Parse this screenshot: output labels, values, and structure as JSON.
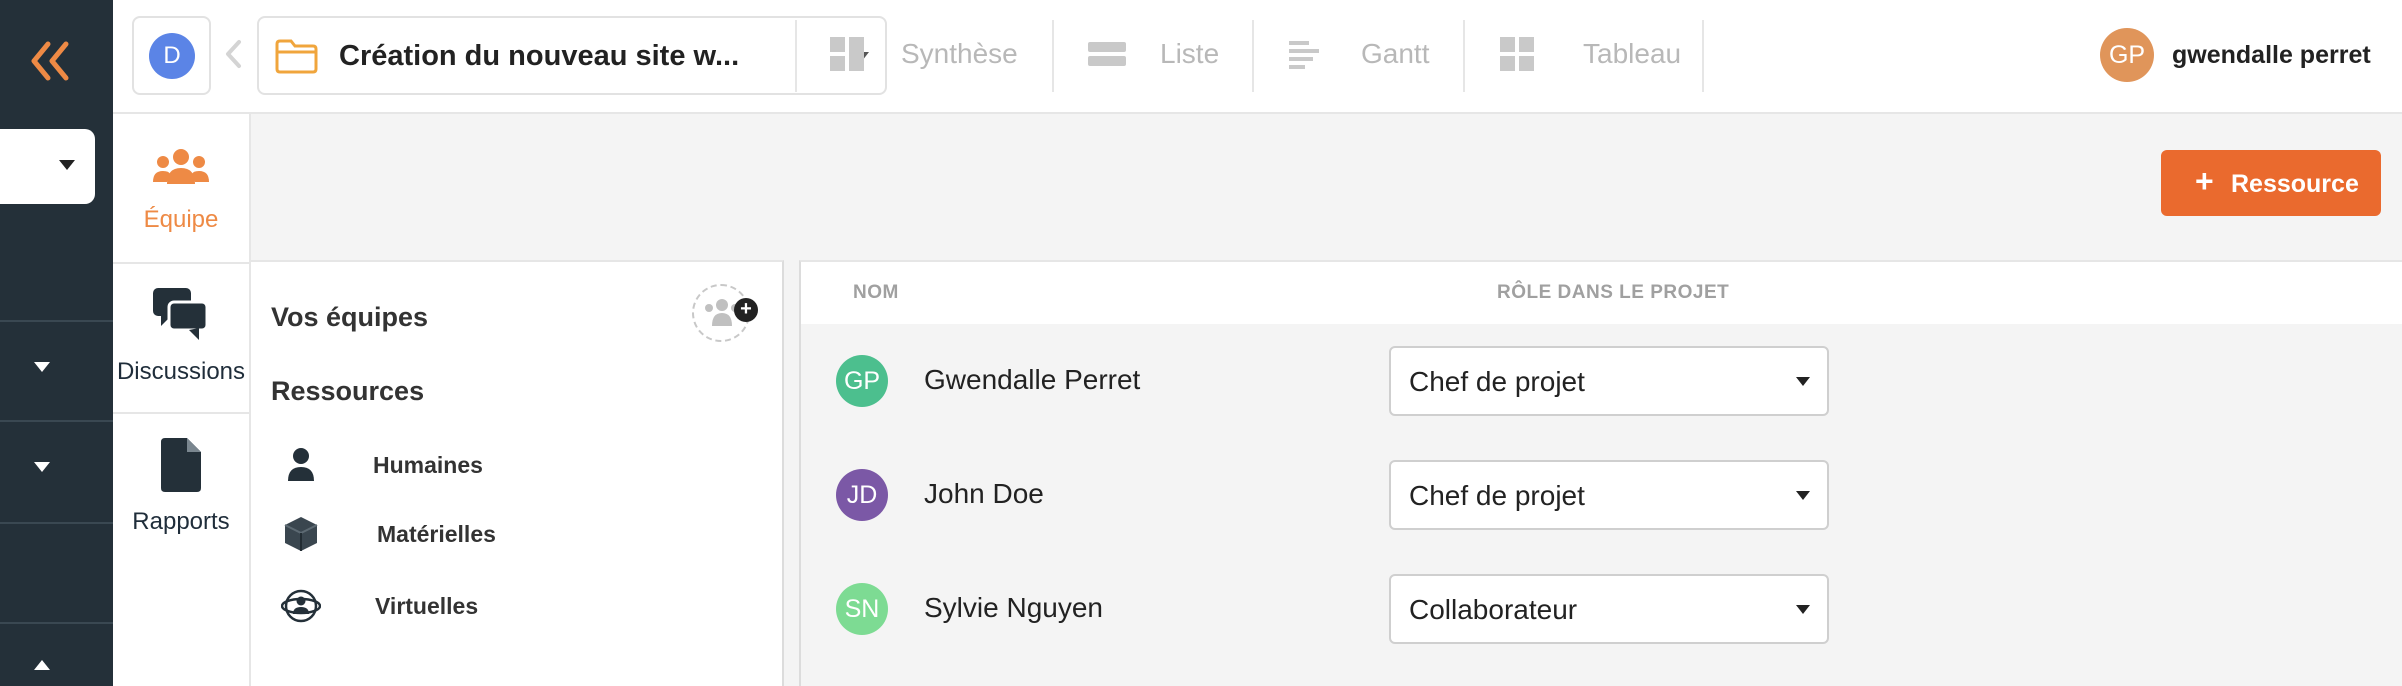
{
  "workspace": {
    "initial": "D"
  },
  "project": {
    "name": "Création du nouveau site w..."
  },
  "views": [
    {
      "label": "Synthèse",
      "icon": "synthesis-icon"
    },
    {
      "label": "Liste",
      "icon": "list-icon"
    },
    {
      "label": "Gantt",
      "icon": "gantt-icon"
    },
    {
      "label": "Tableau",
      "icon": "board-icon"
    }
  ],
  "user": {
    "initials": "GP",
    "name": "gwendalle perret"
  },
  "subnav": [
    {
      "label": "Équipe",
      "icon": "team-icon",
      "active": true
    },
    {
      "label": "Discussions",
      "icon": "discussions-icon",
      "active": false
    },
    {
      "label": "Rapports",
      "icon": "reports-icon",
      "active": false
    }
  ],
  "teams": {
    "title": "Vos équipes",
    "resources_title": "Ressources",
    "items": [
      {
        "label": "Humaines",
        "icon": "person-icon"
      },
      {
        "label": "Matérielles",
        "icon": "cube-icon"
      },
      {
        "label": "Virtuelles",
        "icon": "virtual-icon"
      }
    ]
  },
  "add_resource_button": {
    "label": "Ressource"
  },
  "table": {
    "columns": {
      "name": "NOM",
      "role": "RÔLE DANS LE PROJET"
    },
    "rows": [
      {
        "initials": "GP",
        "name": "Gwendalle Perret",
        "role": "Chef de projet",
        "color": "#4cbf8e"
      },
      {
        "initials": "JD",
        "name": "John Doe",
        "role": "Chef de projet",
        "color": "#7b58a6"
      },
      {
        "initials": "SN",
        "name": "Sylvie Nguyen",
        "role": "Collaborateur",
        "color": "#7ddb93"
      }
    ]
  },
  "colors": {
    "accent": "#ea6a2e",
    "rail": "#243039",
    "active_nav": "#ee8a45"
  }
}
